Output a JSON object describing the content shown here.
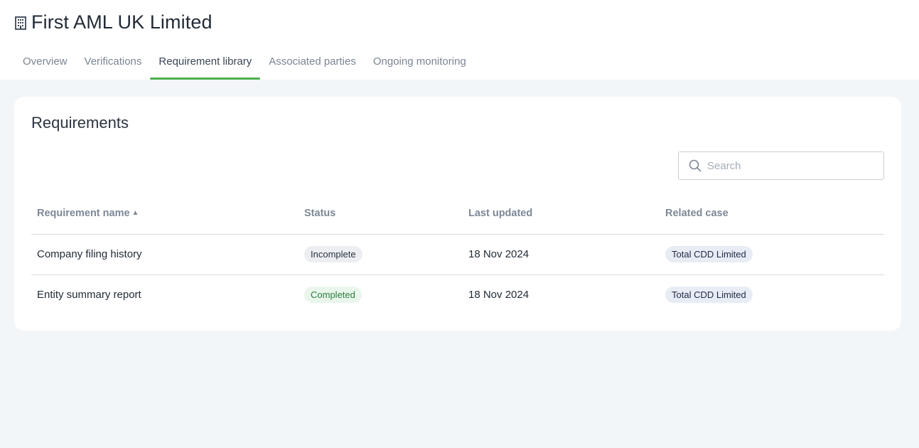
{
  "header": {
    "title": "First AML UK Limited",
    "icon": "building-icon"
  },
  "tabs": [
    {
      "label": "Overview",
      "active": false
    },
    {
      "label": "Verifications",
      "active": false
    },
    {
      "label": "Requirement library",
      "active": true
    },
    {
      "label": "Associated parties",
      "active": false
    },
    {
      "label": "Ongoing monitoring",
      "active": false
    }
  ],
  "card": {
    "title": "Requirements",
    "search": {
      "placeholder": "Search",
      "value": ""
    }
  },
  "table": {
    "columns": [
      "Requirement name",
      "Status",
      "Last updated",
      "Related case"
    ],
    "sort": {
      "column": "Requirement name",
      "direction": "ascending"
    },
    "rows": [
      {
        "name": "Company filing history",
        "status": "Incomplete",
        "last_updated": "18 Nov 2024",
        "related_case": "Total CDD Limited"
      },
      {
        "name": "Entity summary report",
        "status": "Completed",
        "last_updated": "18 Nov 2024",
        "related_case": "Total CDD Limited"
      }
    ]
  },
  "colors": {
    "accent": "#4caf50",
    "background": "#f3f6f9",
    "incomplete_badge": "#eceef1",
    "completed_badge": "#e9f6ec",
    "case_badge": "#e8ecf5"
  }
}
